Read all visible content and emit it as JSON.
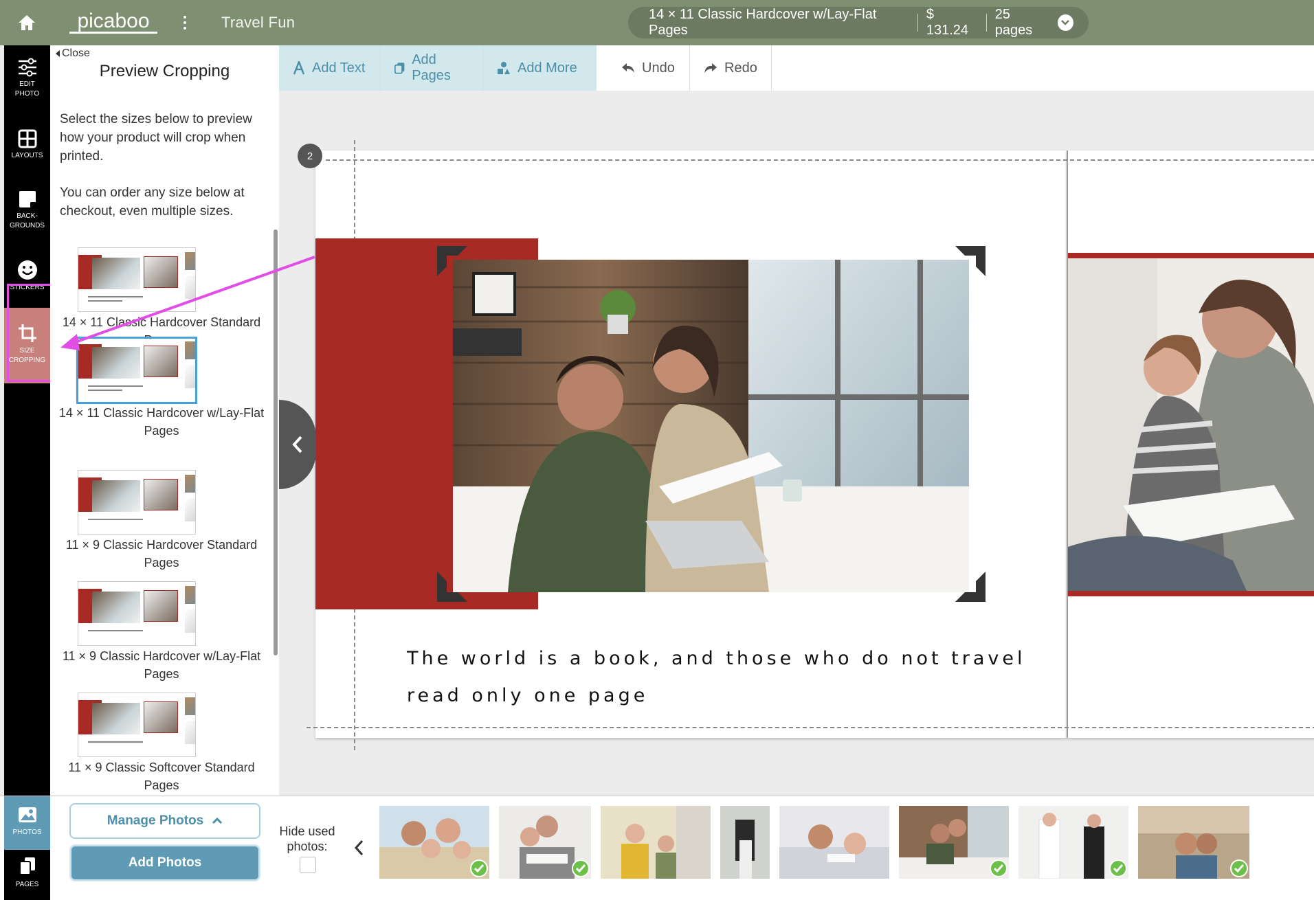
{
  "app": {
    "brand": "picaboo",
    "project_title": "Travel Fun",
    "product": {
      "name": "14 × 11 Classic Hardcover w/Lay-Flat Pages",
      "price": "$ 131.24",
      "pages": "25 pages"
    }
  },
  "rail": {
    "items": [
      {
        "label_1": "EDIT",
        "label_2": "PHOTO",
        "icon": "sliders-icon"
      },
      {
        "label_1": "LAYOUTS",
        "icon": "layouts-icon"
      },
      {
        "label_1": "BACK-",
        "label_2": "GROUNDS",
        "icon": "backgrounds-icon"
      },
      {
        "label_1": "STICKERS",
        "icon": "smiley-icon"
      },
      {
        "label_1": "SIZE",
        "label_2": "CROPPING",
        "icon": "crop-icon",
        "active": true
      }
    ],
    "bottom_items": [
      {
        "label": "PHOTOS",
        "icon": "image-icon",
        "active": true
      },
      {
        "label": "PAGES",
        "icon": "pages-icon"
      }
    ]
  },
  "panel": {
    "close_label": "Close",
    "title": "Preview Cropping",
    "desc_1": "Select the sizes below to preview how your product will crop when printed.",
    "desc_2": "You can order any size below at checkout, even multiple sizes.",
    "sizes": [
      {
        "label": "14 × 11 Classic Hardcover Standard Pages",
        "selected": false
      },
      {
        "label": "14 × 11 Classic Hardcover w/Lay-Flat Pages",
        "selected": true
      },
      {
        "label": "11 × 9 Classic Hardcover Standard Pages",
        "selected": false
      },
      {
        "label": "11 × 9 Classic Hardcover w/Lay-Flat Pages",
        "selected": false
      },
      {
        "label": "11 × 9 Classic Softcover Standard Pages",
        "selected": false
      }
    ]
  },
  "toolbar": {
    "add_text": "Add Text",
    "add_pages": "Add Pages",
    "add_more": "Add More",
    "undo": "Undo",
    "redo": "Redo"
  },
  "canvas": {
    "page_number": "2",
    "quote_line_1": "The world is a book, and those who do not travel",
    "quote_line_2": "read only one page",
    "accent_color": "#a82a24"
  },
  "bottom": {
    "manage_photos": "Manage Photos",
    "add_photos": "Add Photos",
    "hide_used": "Hide used photos:",
    "photos": [
      {
        "name": "family-beach",
        "used": true
      },
      {
        "name": "mother-daughter-reading",
        "used": true
      },
      {
        "name": "boy-painting",
        "used": false
      },
      {
        "name": "wedding-couple-dark",
        "used": false
      },
      {
        "name": "mother-daughter-bed",
        "used": false
      },
      {
        "name": "couple-laptop",
        "used": true
      },
      {
        "name": "wedding-couple-white",
        "used": true
      },
      {
        "name": "travel-selfie",
        "used": true
      }
    ]
  },
  "colors": {
    "topbar": "#7e8f72",
    "teal": "#5f9bb5",
    "highlight": "#e04ee6",
    "check": "#6cc04a"
  }
}
